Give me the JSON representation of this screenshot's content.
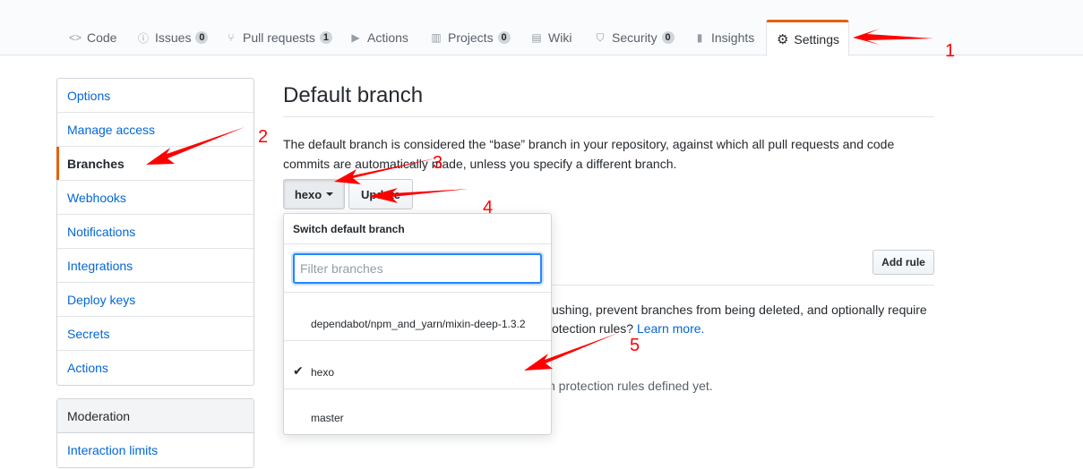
{
  "tabs": [
    {
      "icon": "code-icon",
      "glyph": "<>",
      "label": "Code"
    },
    {
      "icon": "issue-icon",
      "glyph": "ⓘ",
      "label": "Issues",
      "count": "0"
    },
    {
      "icon": "pull-request-icon",
      "glyph": "⑂",
      "label": "Pull requests",
      "count": "1"
    },
    {
      "icon": "play-icon",
      "glyph": "▶",
      "label": "Actions"
    },
    {
      "icon": "project-icon",
      "glyph": "▥",
      "label": "Projects",
      "count": "0"
    },
    {
      "icon": "book-icon",
      "glyph": "▤",
      "label": "Wiki"
    },
    {
      "icon": "shield-icon",
      "glyph": "⛉",
      "label": "Security",
      "count": "0"
    },
    {
      "icon": "graph-icon",
      "glyph": "▮",
      "label": "Insights"
    },
    {
      "icon": "gear-icon",
      "glyph": "⚙",
      "label": "Settings"
    }
  ],
  "sidebar": {
    "items": [
      {
        "label": "Options"
      },
      {
        "label": "Manage access"
      },
      {
        "label": "Branches"
      },
      {
        "label": "Webhooks"
      },
      {
        "label": "Notifications"
      },
      {
        "label": "Integrations"
      },
      {
        "label": "Deploy keys"
      },
      {
        "label": "Secrets"
      },
      {
        "label": "Actions"
      }
    ],
    "moderation": {
      "heading": "Moderation",
      "items": [
        {
          "label": "Interaction limits"
        }
      ]
    }
  },
  "main": {
    "title": "Default branch",
    "description": "The default branch is considered the “base” branch in your repository, against which all pull requests and code commits are automatically made, unless you specify a different branch.",
    "branch_button": "hexo",
    "update_button": "Update",
    "add_rule_button": "Add rule",
    "protection_text_line1": "ushing, prevent branches from being deleted, and optionally require",
    "protection_text_line2": "otection rules?",
    "learn_more": "Learn more.",
    "no_rules_text": "h protection rules defined yet."
  },
  "dropdown": {
    "header": "Switch default branch",
    "filter_placeholder": "Filter branches",
    "branches": [
      {
        "name": "dependabot/npm_and_yarn/mixin-deep-1.3.2",
        "selected": false
      },
      {
        "name": "hexo",
        "selected": true
      },
      {
        "name": "master",
        "selected": false
      }
    ],
    "check_glyph": "✔"
  },
  "annotations": {
    "color": "#ff0000",
    "numbers": [
      "1",
      "2",
      "3",
      "4",
      "5"
    ]
  }
}
